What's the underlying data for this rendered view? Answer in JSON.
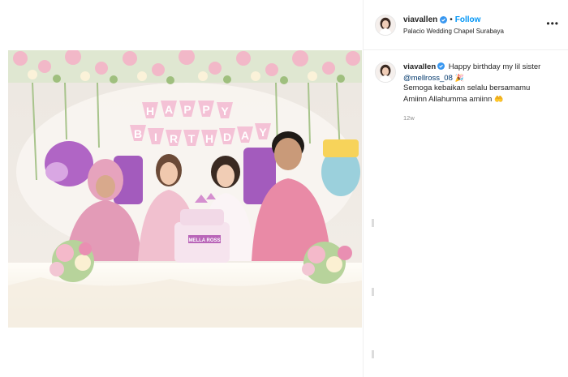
{
  "header": {
    "username": "viavallen",
    "separator": "•",
    "follow_label": "Follow",
    "location": "Palacio Wedding Chapel Surabaya",
    "more_icon": "more-options-icon",
    "verified_icon": "verified-badge-icon"
  },
  "caption": {
    "username": "viavallen",
    "line1_text": "Happy birthday my lil sister",
    "mention": "@mellross_08",
    "line2": "Semoga kebaikan selalu bersamamu",
    "line3": "Amiinn Allahumma amiinn",
    "emoji_hat": "🎉",
    "emoji_hands": "🤲",
    "timestamp": "12w"
  },
  "photo": {
    "banner_text": "HAPPY BIRTHDAY",
    "cake_label": "MELLA ROSS",
    "colors": {
      "banner_pink": "#f4c2d6",
      "wall": "#f6f0ef",
      "tablecloth": "#fbf7ee",
      "shirt_pink": "#e98aa6",
      "balloon_purple": "#9b4fb8"
    }
  },
  "colors": {
    "accent_blue": "#0095f6",
    "mention_blue": "#00376b",
    "muted": "#8e8e8e",
    "border": "#efefef"
  }
}
